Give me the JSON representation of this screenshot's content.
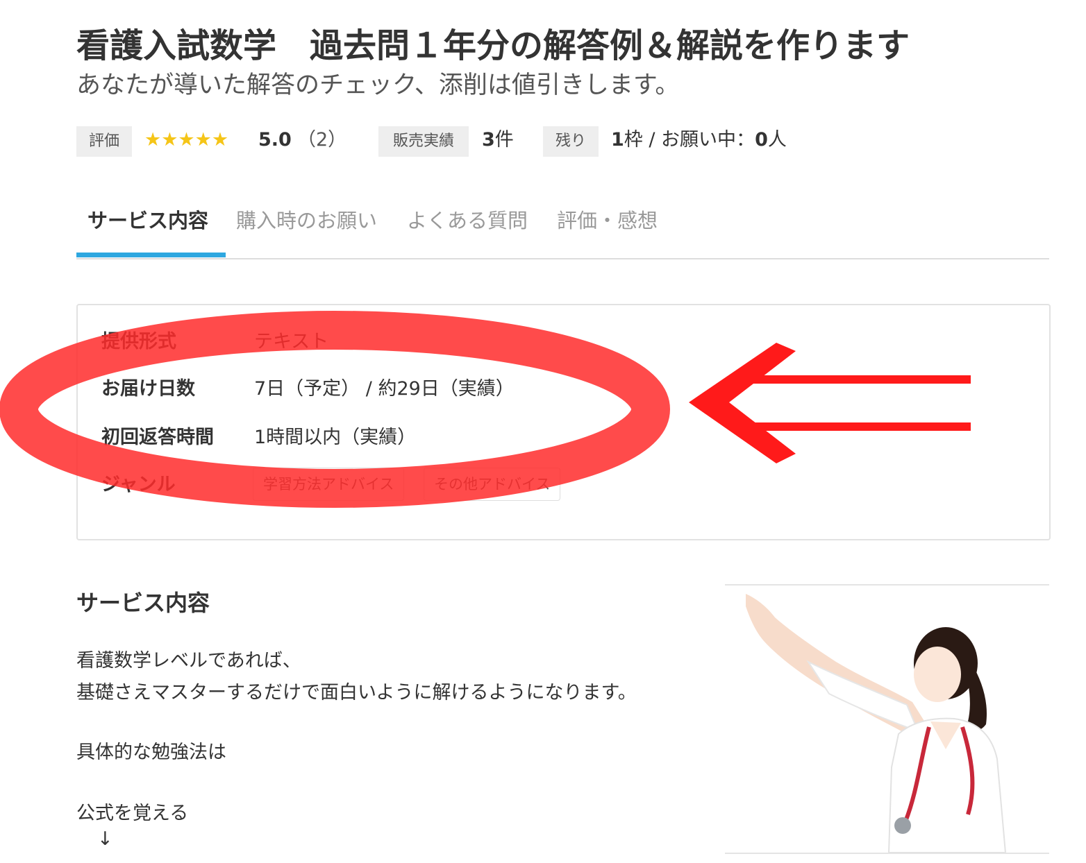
{
  "title": "看護入試数学　過去問１年分の解答例＆解説を作ります",
  "subtitle": "あなたが導いた解答のチェック、添削は値引きします。",
  "stats": {
    "rating_label": "評価",
    "stars": "★★★★★",
    "rating_value": "5.0",
    "rating_count": "（2）",
    "sales_label": "販売実績",
    "sales_value": "3",
    "sales_unit": "件",
    "remaining_label": "残り",
    "remaining_value": "1",
    "remaining_unit": "枠 / お願い中：",
    "requests_value": "0",
    "requests_unit": "人",
    "star_color": "#f5c518"
  },
  "tabs": [
    {
      "label": "サービス内容",
      "active": true
    },
    {
      "label": "購入時のお願い",
      "active": false
    },
    {
      "label": "よくある質問",
      "active": false
    },
    {
      "label": "評価・感想",
      "active": false
    }
  ],
  "info": {
    "format_key": "提供形式",
    "format_value": "テキスト",
    "delivery_key": "お届け日数",
    "delivery_value": "7日（予定） / 約29日（実績）",
    "response_key": "初回返答時間",
    "response_value": "1時間以内（実績）",
    "genre_key": "ジャンル",
    "genres": [
      "学習方法アドバイス",
      "その他アドバイス"
    ]
  },
  "content": {
    "section_title": "サービス内容",
    "lines": [
      "看護数学レベルであれば、",
      "基礎さえマスターするだけで面白いように解けるようになります。",
      "具体的な勉強法は",
      "公式を覚える",
      "↓"
    ]
  },
  "colors": {
    "accent_tab": "#2ea7e0",
    "annotation_red": "#ff2b2b"
  }
}
